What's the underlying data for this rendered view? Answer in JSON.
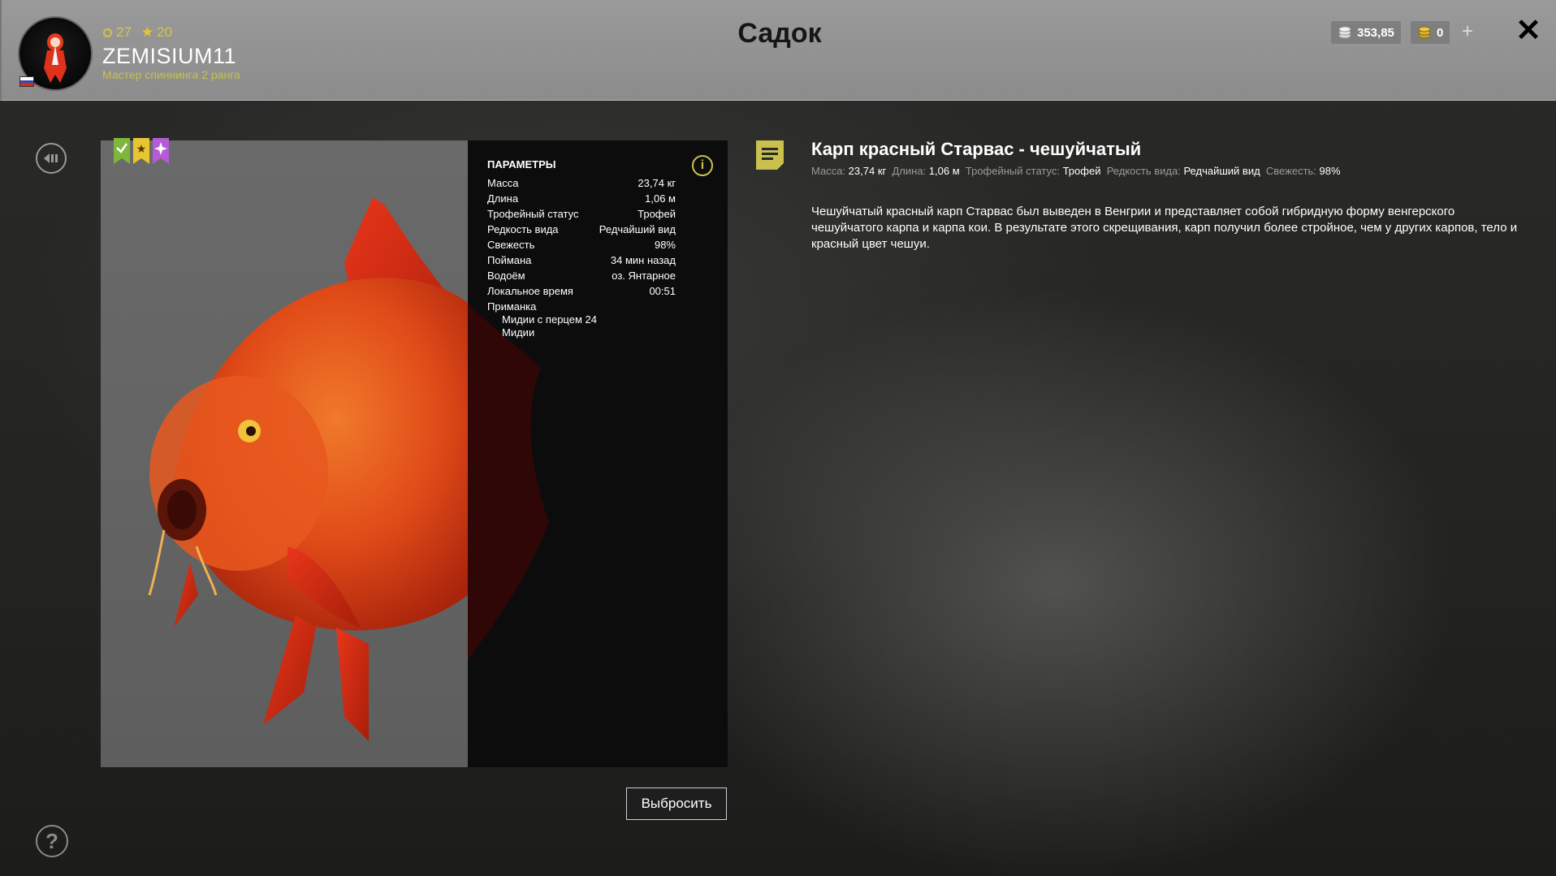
{
  "header": {
    "title": "Садок",
    "player": {
      "level": "27",
      "stars": "20",
      "name": "ZEMISIUM11",
      "rank": "Мастер спиннинга 2 ранга"
    },
    "currency": {
      "silver": "353,85",
      "gold": "0"
    }
  },
  "fish": {
    "name": "Карп красный Старвас - чешуйчатый",
    "summary": {
      "mass_label": "Масса:",
      "mass": "23,74 кг",
      "length_label": "Длина:",
      "length": "1,06 м",
      "trophy_label": "Трофейный статус:",
      "trophy": "Трофей",
      "rarity_label": "Редкость вида:",
      "rarity": "Редчайший вид",
      "fresh_label": "Свежесть:",
      "fresh": "98%"
    },
    "description": "Чешуйчатый красный карп Старвас был выведен в Венгрии и представляет собой гибридную форму венгерского чешуйчатого карпа и карпа кои. В результате этого скрещивания, карп получил более стройное, чем у других карпов, тело и красный цвет чешуи."
  },
  "params": {
    "title": "ПАРАМЕТРЫ",
    "rows": [
      {
        "label": "Масса",
        "value": "23,74 кг"
      },
      {
        "label": "Длина",
        "value": "1,06 м"
      },
      {
        "label": "Трофейный статус",
        "value": "Трофей"
      },
      {
        "label": "Редкость вида",
        "value": "Редчайший вид"
      },
      {
        "label": "Свежесть",
        "value": "98%"
      },
      {
        "label": "Поймана",
        "value": "34 мин назад"
      },
      {
        "label": "Водоём",
        "value": "оз. Янтарное"
      },
      {
        "label": "Локальное время",
        "value": "00:51"
      }
    ],
    "bait_label": "Приманка",
    "baits": [
      "Мидии с перцем 24",
      "Мидии"
    ]
  },
  "buttons": {
    "discard": "Выбросить"
  },
  "colors": {
    "accent": "#c9c04e",
    "badge_green": "#7db83a",
    "badge_yellow": "#e8c531",
    "badge_purple": "#b65bd8"
  }
}
